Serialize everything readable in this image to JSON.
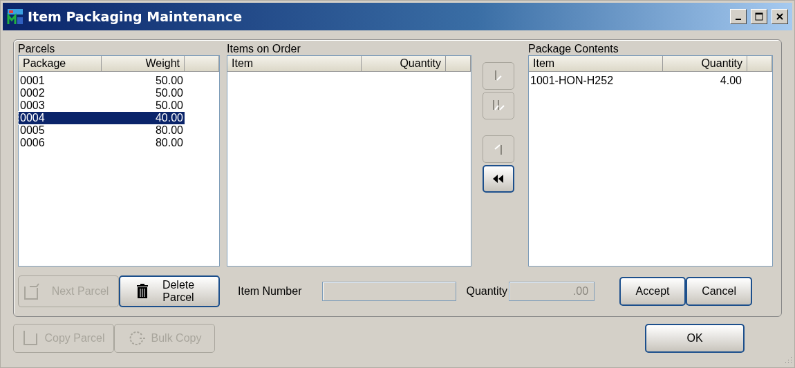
{
  "window": {
    "title": "Item Packaging Maintenance"
  },
  "parcels": {
    "label": "Parcels",
    "columns": [
      "Package",
      "Weight"
    ],
    "rows": [
      {
        "package": "0001",
        "weight": "50.00",
        "selected": false
      },
      {
        "package": "0002",
        "weight": "50.00",
        "selected": false
      },
      {
        "package": "0003",
        "weight": "50.00",
        "selected": false
      },
      {
        "package": "0004",
        "weight": "40.00",
        "selected": true
      },
      {
        "package": "0005",
        "weight": "80.00",
        "selected": false
      },
      {
        "package": "0006",
        "weight": "80.00",
        "selected": false
      }
    ]
  },
  "items_on_order": {
    "label": "Items on Order",
    "columns": [
      "Item",
      "Quantity"
    ]
  },
  "transfer_buttons": [
    {
      "kind": "add-one",
      "disabled": true
    },
    {
      "kind": "add-all",
      "disabled": true
    },
    {
      "kind": "remove-one",
      "disabled": true
    },
    {
      "kind": "remove-all",
      "disabled": false
    }
  ],
  "package_contents": {
    "label": "Package Contents",
    "columns": [
      "Item",
      "Quantity"
    ],
    "rows": [
      {
        "item": "1001-HON-H252",
        "quantity": "4.00",
        "selected": false
      }
    ]
  },
  "parcel_buttons": [
    {
      "kind": "next",
      "label": "Next Parcel",
      "disabled": true
    },
    {
      "kind": "delete",
      "label": "Delete Parcel",
      "disabled": false
    }
  ],
  "item_number": {
    "label": "Item Number"
  },
  "quantity": {
    "label": "Quantity",
    "value": ".00"
  },
  "entry_buttons": [
    {
      "label": "Accept",
      "disabled": false
    },
    {
      "label": "Cancel",
      "disabled": false
    }
  ],
  "copy_buttons": [
    {
      "kind": "copy",
      "label": "Copy Parcel",
      "disabled": true
    },
    {
      "kind": "bulk",
      "label": "Bulk Copy",
      "disabled": true
    }
  ],
  "ok_button": {
    "label": "OK"
  }
}
